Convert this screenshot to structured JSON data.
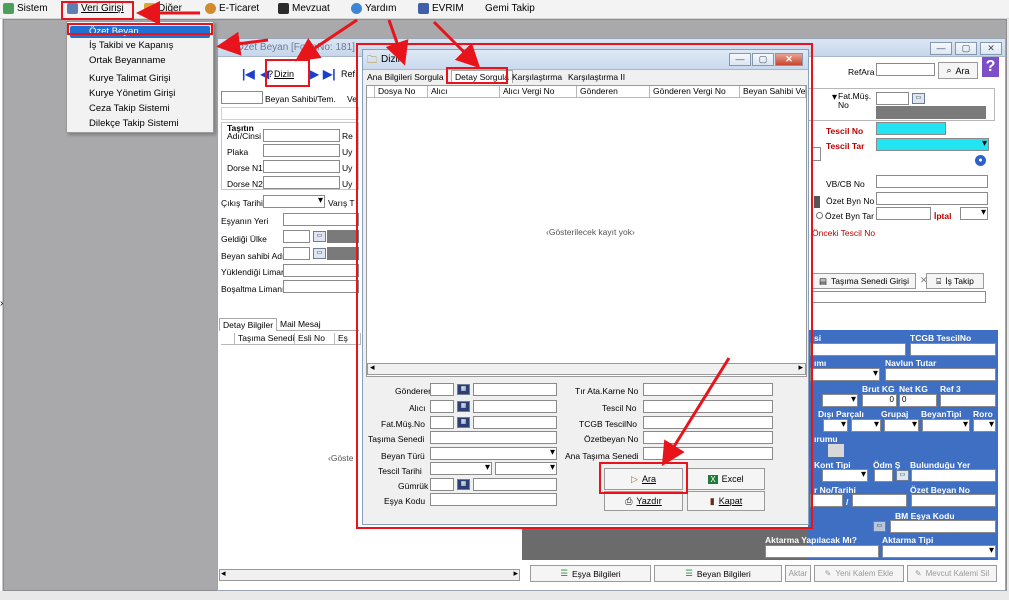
{
  "menubar": {
    "items": [
      {
        "label": "Sistem",
        "icon": "system-icon"
      },
      {
        "label": "Veri Girişi",
        "icon": "data-entry-icon"
      },
      {
        "label": "Diğer",
        "icon": "other-icon"
      },
      {
        "label": "E-Ticaret",
        "icon": "ecommerce-icon"
      },
      {
        "label": "Mevzuat",
        "icon": "legislation-icon"
      },
      {
        "label": "Yardım",
        "icon": "help-icon"
      },
      {
        "label": "EVRIM",
        "icon": "evrim-icon"
      },
      {
        "label": "Gemi Takip",
        "icon": ""
      }
    ]
  },
  "submenu": {
    "items": [
      "Özet Beyan",
      "İş Takibi ve Kapanış",
      "Ortak Beyanname",
      "Kurye Talimat Girişi",
      "Kurye Yönetim Girişi",
      "Ceza Takip Sistemi",
      "Dilekçe Takip Sistemi"
    ],
    "selected": "Özet Beyan"
  },
  "main_form": {
    "title": "Özet Beyan [FormNo: 181]",
    "nav": {
      "dizin_label": "Dizin",
      "ref_label": "Ref"
    },
    "right": {
      "refara_label": "RefAra",
      "ara_button": "Ara",
      "fat_mus_no": "Fat.Müş. No",
      "tescil_no": "Tescil No",
      "tescil_tar": "Tescil Tar",
      "vb_cb_no": "VB/CB No",
      "ozet_byn_no": "Özet Byn No",
      "ozet_byn_tar": "Özet Byn Tar",
      "iptal": "İptal",
      "onceki_tescil": "Önceki Tescil No",
      "tasima_btn": "Taşıma Senedi Girişi",
      "is_takip_btn": "İş Takip"
    },
    "left": {
      "beyan_sahibi": "Beyan Sahibi/Tem.",
      "v_label": "Ve",
      "tasitin": "Taşıtın",
      "adi_cinsi": "Adı/Cinsi",
      "re_label": "Re",
      "plaka": "Plaka",
      "dorse_n1": "Dorse N1",
      "dorse_n2": "Dorse N2",
      "uy": "Uy",
      "cikis_tarihi": "Çıkış Tarihi",
      "varis_t": "Varış T",
      "esyanin_yeri": "Eşyanın Yeri",
      "geldigi_ulke": "Geldiği Ülke",
      "beyan_sahibi_adi": "Beyan sahibi Adı",
      "yuklendigi_liman": "Yüklendiği Liman",
      "bosaltma_limani": "Boşaltma Limanı"
    },
    "bottom_tabs": [
      "Detay Bilgiler",
      "Mail Mesaj"
    ],
    "bottom_grid": {
      "columns": [
        "Taşıma Senedi",
        "Esli No",
        "Eş"
      ]
    },
    "bottom_empty": "‹Göste",
    "blue_panel": {
      "labels": [
        "si",
        "TCGB TescilNo",
        "ımı",
        "Navlun Tutar",
        "Brut KG",
        "Net KG",
        "Ref 3",
        "Dışı Parçalı",
        "Grupaj",
        "BeyanTipi",
        "Roro",
        "ırumu",
        "Kont Tipi",
        "Ödm Ş",
        "Bulunduğu Yer",
        "r No/Tarihi",
        "Özet Beyan No",
        "BM Eşya Kodu",
        "Aktarma Yapılacak Mı?",
        "Aktarma Tipi"
      ],
      "brut_value": "0",
      "net_value": "0",
      "slash": "/"
    },
    "footer": {
      "esya_btn": "Eşya Bilgileri",
      "beyan_btn": "Beyan Bilgileri",
      "aktar": "Aktar",
      "yeni_kalem": "Yeni Kalem Ekle",
      "mevcut_kalem": "Mevcut Kalemi Sil"
    }
  },
  "dizin": {
    "title": "Dizin",
    "tabs": [
      "Ana Bilgileri Sorgula",
      "Detay Sorgula",
      "Karşılaştırma",
      "Karşılaştırma II"
    ],
    "active_tab": "Detay Sorgula",
    "columns": [
      "Dosya No",
      "Alıcı",
      "Alıcı Vergi No",
      "Gönderen",
      "Gönderen Vergi No",
      "Beyan Sahibi Ve"
    ],
    "empty": "‹Gösterilecek kayıt yok›",
    "fields_left": [
      "Gönderen",
      "Alıcı",
      "Fat.Müş.No",
      "Taşıma Senedi",
      "Beyan Türü",
      "Tescil Tarihi",
      "Gümrük",
      "Eşya Kodu"
    ],
    "fields_right": [
      "Tır Ata.Karne No",
      "Tescil No",
      "TCGB TescilNo",
      "Özetbeyan No",
      "Ana Taşıma Senedi"
    ],
    "buttons": {
      "ara": "Ara",
      "excel": "Excel",
      "yazdir": "Yazdır",
      "kapat": "Kapat"
    }
  },
  "colors": {
    "annotation": "#e8141b",
    "selection": "#1e70d2",
    "cyan_field": "#22e4f2",
    "blue_panel": "#3e6fc3",
    "dark_red_label": "#c00000"
  }
}
